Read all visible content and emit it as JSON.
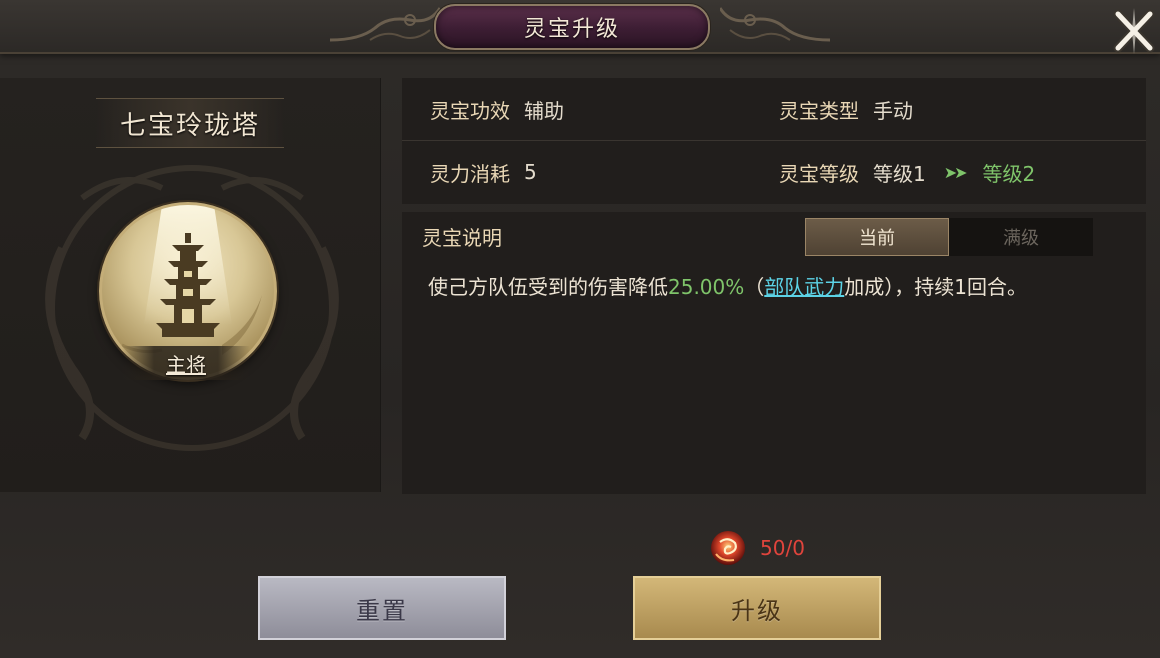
{
  "header": {
    "title": "灵宝升级",
    "close_icon": "close-x-icon"
  },
  "item": {
    "name": "七宝玲珑塔",
    "role_tag": "主将",
    "emblem_icon": "pagoda-icon"
  },
  "info": {
    "effect_label": "灵宝功效",
    "effect_value": "辅助",
    "type_label": "灵宝类型",
    "type_value": "手动",
    "cost_label": "灵力消耗",
    "cost_value": "5",
    "level_label": "灵宝等级",
    "level_current": "等级1",
    "level_arrow": "➤➤",
    "level_next": "等级2"
  },
  "description": {
    "title": "灵宝说明",
    "tabs": [
      {
        "label": "当前",
        "active": true
      },
      {
        "label": "满级",
        "active": false
      }
    ],
    "text_before": "使己方队伍受到的伤害降低",
    "value": "25.00%",
    "text_paren_open": "（",
    "link": "部队武力",
    "text_after": "加成），持续1回合。"
  },
  "cost": {
    "icon": "spirit-orb-icon",
    "value": "50/0"
  },
  "buttons": {
    "reset": "重置",
    "upgrade": "升级"
  },
  "colors": {
    "highlight_green": "#7fc46a",
    "link_cyan": "#5cd3e6",
    "cost_red": "#e0443c",
    "label_gold": "#e9d7b5"
  }
}
